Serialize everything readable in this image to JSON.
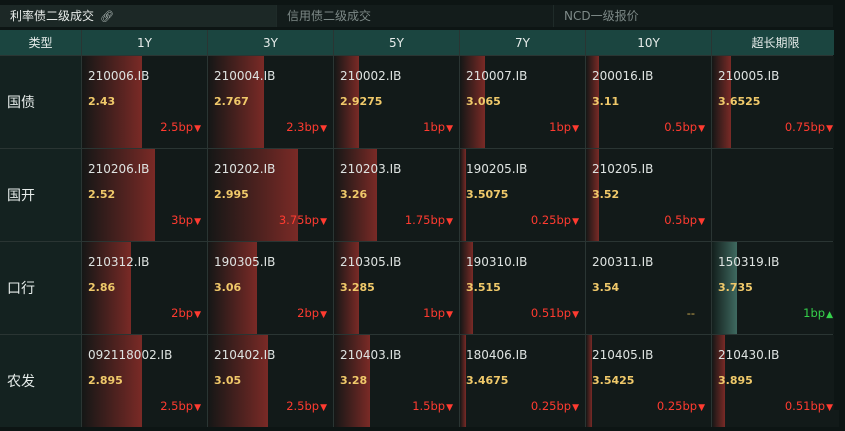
{
  "tabs": [
    {
      "label": "利率债二级成交",
      "active": true,
      "icon": "link-icon"
    },
    {
      "label": "信用债二级成交",
      "active": false
    },
    {
      "label": "NCD一级报价",
      "active": false
    }
  ],
  "table": {
    "corner": "类型",
    "columns": [
      "1Y",
      "3Y",
      "5Y",
      "7Y",
      "10Y",
      "超长期限"
    ],
    "rows": [
      {
        "label": "国债",
        "cells": [
          {
            "code": "210006.IB",
            "yield": "2.43",
            "change": "2.5bp",
            "dir": "down",
            "bar": 0.48
          },
          {
            "code": "210004.IB",
            "yield": "2.767",
            "change": "2.3bp",
            "dir": "down",
            "bar": 0.45
          },
          {
            "code": "210002.IB",
            "yield": "2.9275",
            "change": "1bp",
            "dir": "down",
            "bar": 0.2
          },
          {
            "code": "210007.IB",
            "yield": "3.065",
            "change": "1bp",
            "dir": "down",
            "bar": 0.2
          },
          {
            "code": "200016.IB",
            "yield": "3.11",
            "change": "0.5bp",
            "dir": "down",
            "bar": 0.1
          },
          {
            "code": "210005.IB",
            "yield": "3.6525",
            "change": "0.75bp",
            "dir": "down",
            "bar": 0.15
          }
        ]
      },
      {
        "label": "国开",
        "cells": [
          {
            "code": "210206.IB",
            "yield": "2.52",
            "change": "3bp",
            "dir": "down",
            "bar": 0.58
          },
          {
            "code": "210202.IB",
            "yield": "2.995",
            "change": "3.75bp",
            "dir": "down",
            "bar": 0.72
          },
          {
            "code": "210203.IB",
            "yield": "3.26",
            "change": "1.75bp",
            "dir": "down",
            "bar": 0.34
          },
          {
            "code": "190205.IB",
            "yield": "3.5075",
            "change": "0.25bp",
            "dir": "down",
            "bar": 0.05
          },
          {
            "code": "210205.IB",
            "yield": "3.52",
            "change": "0.5bp",
            "dir": "down",
            "bar": 0.1
          },
          {
            "code": "",
            "yield": "",
            "change": "",
            "dir": "none",
            "bar": 0
          }
        ]
      },
      {
        "label": "口行",
        "cells": [
          {
            "code": "210312.IB",
            "yield": "2.86",
            "change": "2bp",
            "dir": "down",
            "bar": 0.39
          },
          {
            "code": "190305.IB",
            "yield": "3.06",
            "change": "2bp",
            "dir": "down",
            "bar": 0.39
          },
          {
            "code": "210305.IB",
            "yield": "3.285",
            "change": "1bp",
            "dir": "down",
            "bar": 0.2
          },
          {
            "code": "190310.IB",
            "yield": "3.515",
            "change": "0.51bp",
            "dir": "down",
            "bar": 0.1
          },
          {
            "code": "200311.IB",
            "yield": "3.54",
            "change": "--",
            "dir": "flat",
            "bar": 0
          },
          {
            "code": "150319.IB",
            "yield": "3.735",
            "change": "1bp",
            "dir": "up",
            "bar": 0.2
          }
        ]
      },
      {
        "label": "农发",
        "cells": [
          {
            "code": "092118002.IB",
            "yield": "2.895",
            "change": "2.5bp",
            "dir": "down",
            "bar": 0.48
          },
          {
            "code": "210402.IB",
            "yield": "3.05",
            "change": "2.5bp",
            "dir": "down",
            "bar": 0.48
          },
          {
            "code": "210403.IB",
            "yield": "3.28",
            "change": "1.5bp",
            "dir": "down",
            "bar": 0.29
          },
          {
            "code": "180406.IB",
            "yield": "3.4675",
            "change": "0.25bp",
            "dir": "down",
            "bar": 0.05
          },
          {
            "code": "210405.IB",
            "yield": "3.5425",
            "change": "0.25bp",
            "dir": "down",
            "bar": 0.05
          },
          {
            "code": "210430.IB",
            "yield": "3.895",
            "change": "0.51bp",
            "dir": "down",
            "bar": 0.1
          }
        ]
      }
    ]
  },
  "colors": {
    "down": "#ff3b30",
    "up": "#35d04a",
    "yield": "#f0c96a",
    "header_bg": "#1b4540"
  }
}
